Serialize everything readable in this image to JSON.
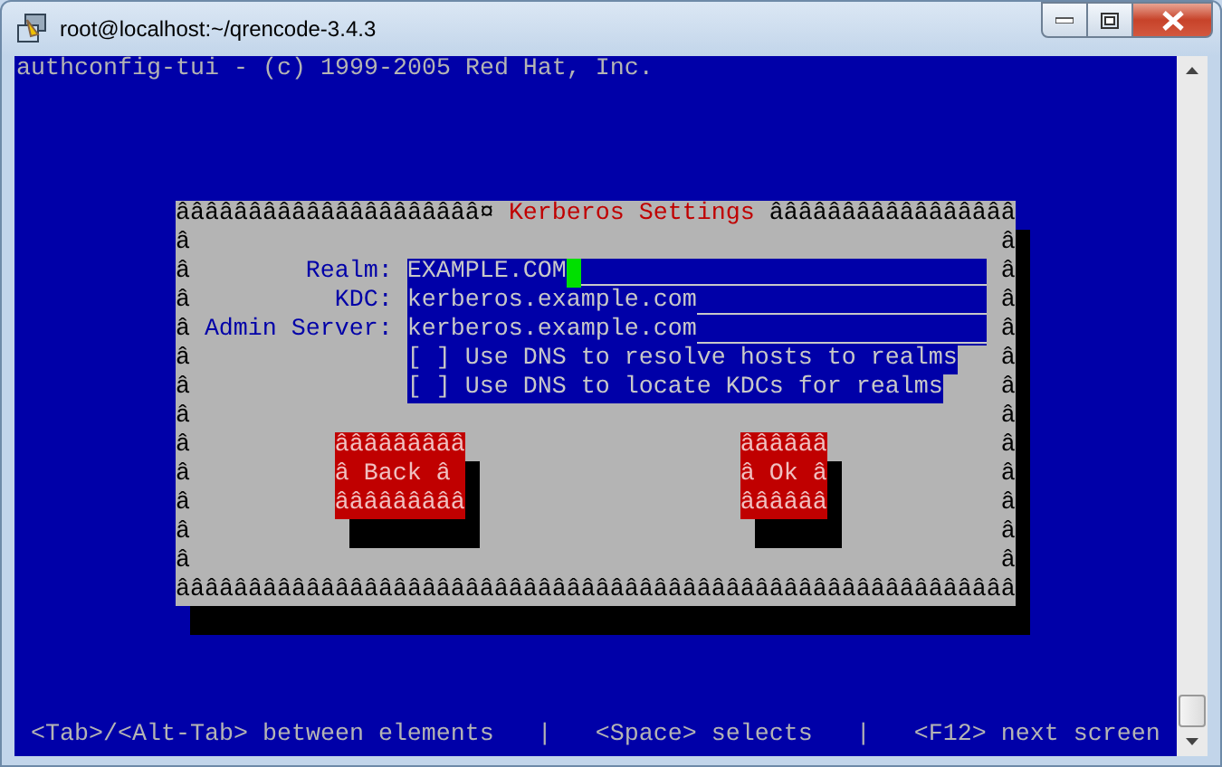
{
  "window": {
    "title": "root@localhost:~/qrencode-3.4.3"
  },
  "terminal": {
    "header": "authconfig-tui - (c) 1999-2005 Red Hat, Inc.",
    "dialog": {
      "border_top_left": "âââââââââââââââââââââ¤",
      "title": "Kerberos Settings",
      "border_top_right": "âââââââââââââââââ",
      "border_left": "ââââââââââââ",
      "border_right": "ââââââââââââ",
      "border_bottom": "ââââââââââââââââââââââââââââââââââââââââââââââââââââââââââ",
      "fields": [
        {
          "label": "Realm:",
          "value": "EXAMPLE.COM",
          "focused": true
        },
        {
          "label": "KDC:",
          "value": "kerberos.example.com",
          "focused": false
        },
        {
          "label": "Admin Server:",
          "value": "kerberos.example.com",
          "focused": false
        }
      ],
      "checkboxes": [
        {
          "box": "[ ]",
          "label": "Use DNS to resolve hosts to realms",
          "checked": false
        },
        {
          "box": "[ ]",
          "label": "Use DNS to locate KDCs for realms",
          "checked": false
        }
      ],
      "buttons": [
        {
          "top": "âââââââââ",
          "label": "â Back â",
          "bottom": "âââââââââ"
        },
        {
          "top": "ââââââ",
          "label": "â Ok â",
          "bottom": "ââââââ"
        }
      ]
    },
    "hint": "<Tab>/<Alt-Tab> between elements   |   <Space> selects   |   <F12> next screen"
  }
}
